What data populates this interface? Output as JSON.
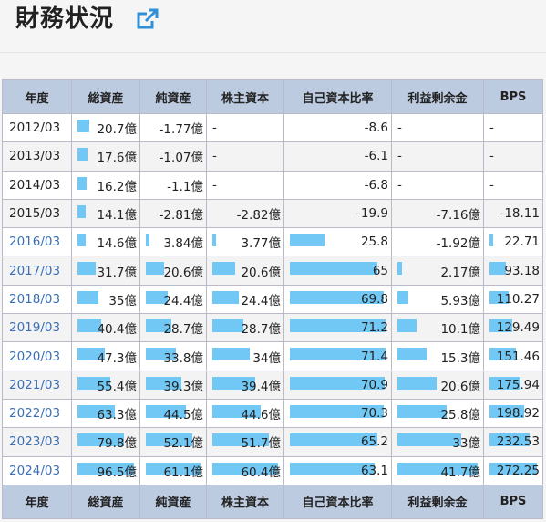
{
  "title": "財務状況",
  "colors": {
    "header_bg": "#bccbe0",
    "bar": "#72c8f5",
    "link": "#3a6fb6"
  },
  "table": {
    "headers": [
      "年度",
      "総資産",
      "純資産",
      "株主資本",
      "自己資本比率",
      "利益剰余金",
      "BPS"
    ],
    "rows": [
      {
        "year": "2012/03",
        "link": false,
        "cells": [
          "20.7億",
          "-1.77億",
          "-",
          "-8.6",
          "-",
          "-"
        ],
        "bars": [
          0.214,
          0,
          0,
          0,
          0,
          0
        ]
      },
      {
        "year": "2013/03",
        "link": false,
        "cells": [
          "17.6億",
          "-1.07億",
          "-",
          "-6.1",
          "-",
          "-"
        ],
        "bars": [
          0.182,
          0,
          0,
          0,
          0,
          0
        ]
      },
      {
        "year": "2014/03",
        "link": false,
        "cells": [
          "16.2億",
          "-1.1億",
          "-",
          "-6.8",
          "-",
          "-"
        ],
        "bars": [
          0.168,
          0,
          0,
          0,
          0,
          0
        ]
      },
      {
        "year": "2015/03",
        "link": false,
        "cells": [
          "14.1億",
          "-2.81億",
          "-2.82億",
          "-19.9",
          "-7.16億",
          "-18.11"
        ],
        "bars": [
          0.146,
          0,
          0,
          0,
          0,
          0
        ]
      },
      {
        "year": "2016/03",
        "link": true,
        "cells": [
          "14.6億",
          "3.84億",
          "3.77億",
          "25.8",
          "-1.92億",
          "22.71"
        ],
        "bars": [
          0.151,
          0.063,
          0.062,
          0.362,
          0,
          0.083
        ]
      },
      {
        "year": "2017/03",
        "link": true,
        "cells": [
          "31.7億",
          "20.6億",
          "20.6億",
          "65",
          "2.17億",
          "93.18"
        ],
        "bars": [
          0.328,
          0.337,
          0.341,
          0.913,
          0.052,
          0.342
        ]
      },
      {
        "year": "2018/03",
        "link": true,
        "cells": [
          "35億",
          "24.4億",
          "24.4億",
          "69.8",
          "5.93億",
          "110.27"
        ],
        "bars": [
          0.363,
          0.399,
          0.404,
          0.98,
          0.142,
          0.405
        ]
      },
      {
        "year": "2019/03",
        "link": true,
        "cells": [
          "40.4億",
          "28.7億",
          "28.7億",
          "71.2",
          "10.1億",
          "129.49"
        ],
        "bars": [
          0.419,
          0.47,
          0.475,
          1.0,
          0.242,
          0.476
        ]
      },
      {
        "year": "2020/03",
        "link": true,
        "cells": [
          "47.3億",
          "33.8億",
          "34億",
          "71.4",
          "15.3億",
          "151.46"
        ],
        "bars": [
          0.49,
          0.553,
          0.563,
          1.0,
          0.367,
          0.556
        ]
      },
      {
        "year": "2021/03",
        "link": true,
        "cells": [
          "55.4億",
          "39.3億",
          "39.4億",
          "70.9",
          "20.6億",
          "175.94"
        ],
        "bars": [
          0.574,
          0.643,
          0.652,
          0.993,
          0.494,
          0.646
        ]
      },
      {
        "year": "2022/03",
        "link": true,
        "cells": [
          "63.3億",
          "44.5億",
          "44.6億",
          "70.3",
          "25.8億",
          "198.92"
        ],
        "bars": [
          0.656,
          0.728,
          0.738,
          0.985,
          0.619,
          0.731
        ]
      },
      {
        "year": "2023/03",
        "link": true,
        "cells": [
          "79.8億",
          "52.1億",
          "51.7億",
          "65.2",
          "33億",
          "232.53"
        ],
        "bars": [
          0.827,
          0.853,
          0.856,
          0.913,
          0.791,
          0.854
        ]
      },
      {
        "year": "2024/03",
        "link": true,
        "cells": [
          "96.5億",
          "61.1億",
          "60.4億",
          "63.1",
          "41.7億",
          "272.25"
        ],
        "bars": [
          1.0,
          1.0,
          1.0,
          0.884,
          1.0,
          1.0
        ]
      }
    ]
  }
}
